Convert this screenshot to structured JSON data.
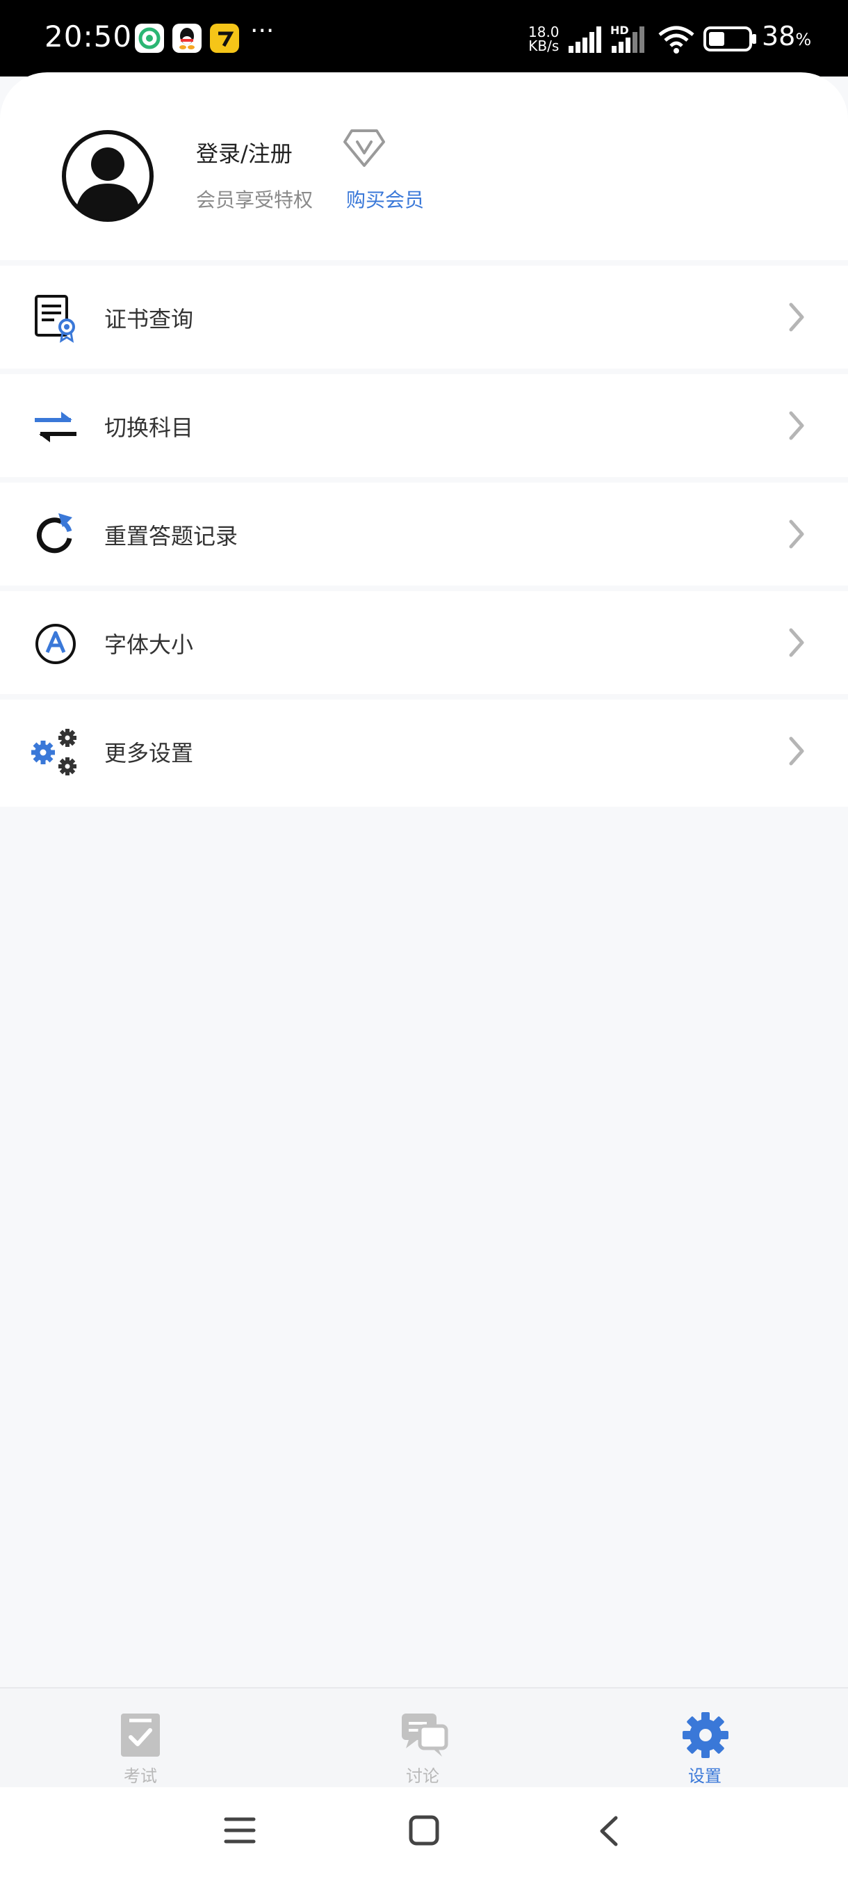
{
  "status_bar": {
    "time": "20:50",
    "app_icons": [
      "wechat-app-icon",
      "qq-icon",
      "yellow-app-icon"
    ],
    "overflow": "···",
    "net_speed_value": "18.0",
    "net_speed_unit": "KB/s",
    "hd_label": "HD",
    "battery_percent": "38",
    "battery_unit": "%"
  },
  "profile": {
    "login_label": "登录/注册",
    "member_text": "会员享受特权",
    "buy_member": "购买会员"
  },
  "menu": [
    {
      "label": "证书查询",
      "icon": "certificate-icon"
    },
    {
      "label": "切换科目",
      "icon": "switch-icon"
    },
    {
      "label": "重置答题记录",
      "icon": "reset-icon"
    },
    {
      "label": "字体大小",
      "icon": "font-size-icon"
    },
    {
      "label": "更多设置",
      "icon": "gears-icon"
    }
  ],
  "tabs": [
    {
      "label": "考试",
      "icon": "exam-icon",
      "active": false
    },
    {
      "label": "讨论",
      "icon": "discussion-icon",
      "active": false
    },
    {
      "label": "设置",
      "icon": "settings-icon",
      "active": true
    }
  ],
  "colors": {
    "accent": "#3a78d8",
    "inactive": "#b8b8b8",
    "background": "#f7f8fa"
  }
}
